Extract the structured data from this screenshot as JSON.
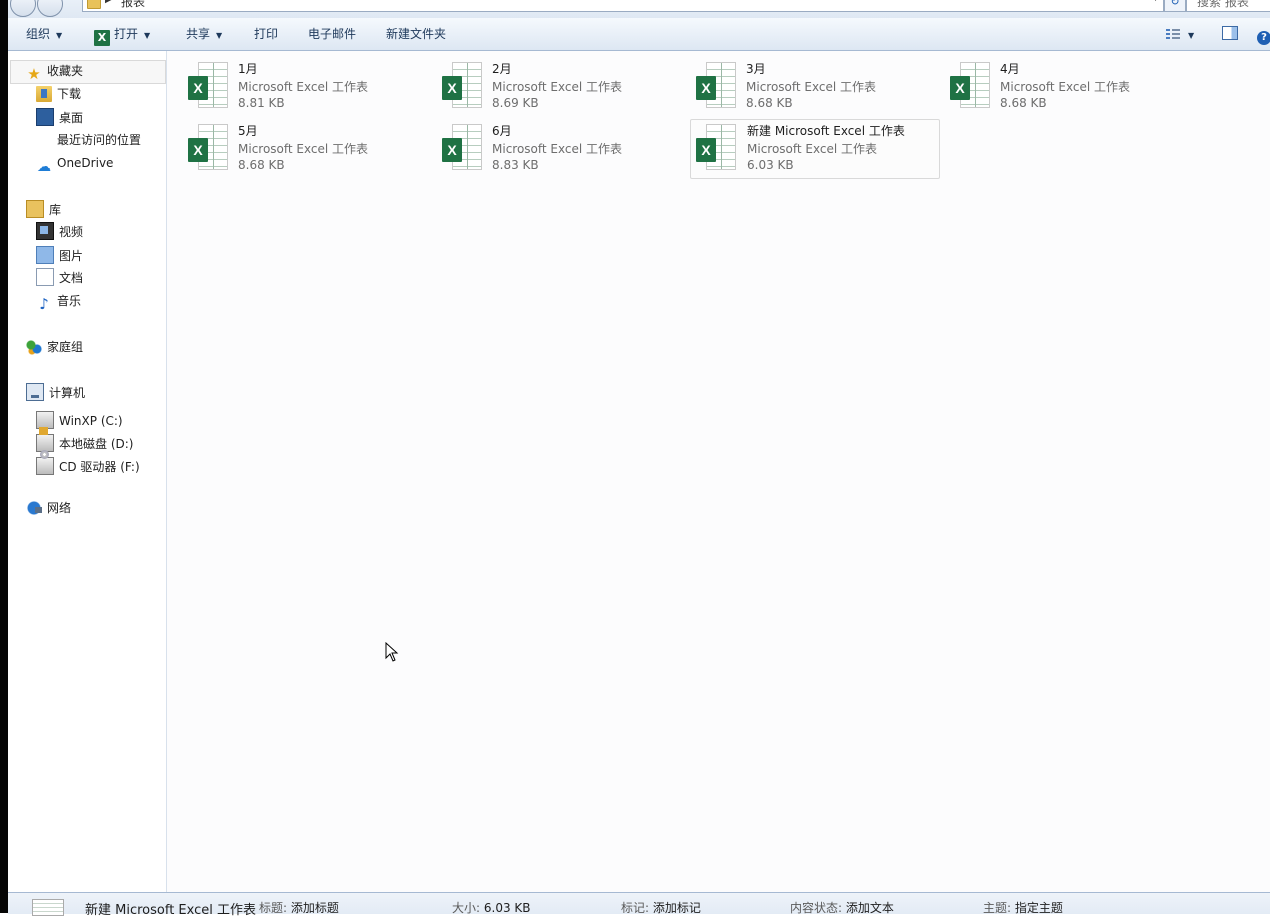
{
  "address": {
    "breadcrumb": "报表",
    "search_placeholder": "搜索 报表"
  },
  "toolbar": {
    "organize": "组织",
    "open": "打开",
    "share": "共享",
    "print": "打印",
    "email": "电子邮件",
    "new_folder": "新建文件夹"
  },
  "nav": {
    "favorites": "收藏夹",
    "downloads": "下载",
    "desktop": "桌面",
    "recent": "最近访问的位置",
    "onedrive": "OneDrive",
    "libraries": "库",
    "videos": "视频",
    "pictures": "图片",
    "documents": "文档",
    "music": "音乐",
    "homegroup": "家庭组",
    "computer": "计算机",
    "drive_c": "WinXP (C:)",
    "drive_d": "本地磁盘 (D:)",
    "drive_f": "CD 驱动器 (F:)",
    "network": "网络"
  },
  "files": [
    {
      "name": "1月",
      "type": "Microsoft Excel 工作表",
      "size": "8.81 KB"
    },
    {
      "name": "2月",
      "type": "Microsoft Excel 工作表",
      "size": "8.69 KB"
    },
    {
      "name": "3月",
      "type": "Microsoft Excel 工作表",
      "size": "8.68 KB"
    },
    {
      "name": "4月",
      "type": "Microsoft Excel 工作表",
      "size": "8.68 KB"
    },
    {
      "name": "5月",
      "type": "Microsoft Excel 工作表",
      "size": "8.68 KB"
    },
    {
      "name": "6月",
      "type": "Microsoft Excel 工作表",
      "size": "8.83 KB"
    },
    {
      "name": "新建 Microsoft Excel 工作表",
      "type": "Microsoft Excel 工作表",
      "size": "6.03 KB"
    }
  ],
  "details": {
    "name": "新建 Microsoft Excel 工作表",
    "title_label": "标题:",
    "title_value": "添加标题",
    "size_label": "大小:",
    "size_value": "6.03 KB",
    "tags_label": "标记:",
    "tags_value": "添加标记",
    "status_label": "内容状态:",
    "status_value": "添加文本",
    "subject_label": "主题:",
    "subject_value": "指定主题"
  },
  "icons": {
    "excel": "excel-file-icon",
    "favorites": "star-icon",
    "downloads": "downloads-folder-icon",
    "desktop": "desktop-icon",
    "onedrive": "cloud-icon",
    "libraries": "library-icon",
    "videos": "video-icon",
    "pictures": "picture-icon",
    "documents": "document-icon",
    "music": "music-note-icon",
    "homegroup": "homegroup-icon",
    "computer": "computer-icon",
    "drive": "hard-drive-icon",
    "cd": "cd-drive-icon",
    "network": "network-icon"
  },
  "colors": {
    "excel_green": "#1f7244",
    "toolbar_text": "#1e395b",
    "selection_border": "#d9d9d9"
  }
}
